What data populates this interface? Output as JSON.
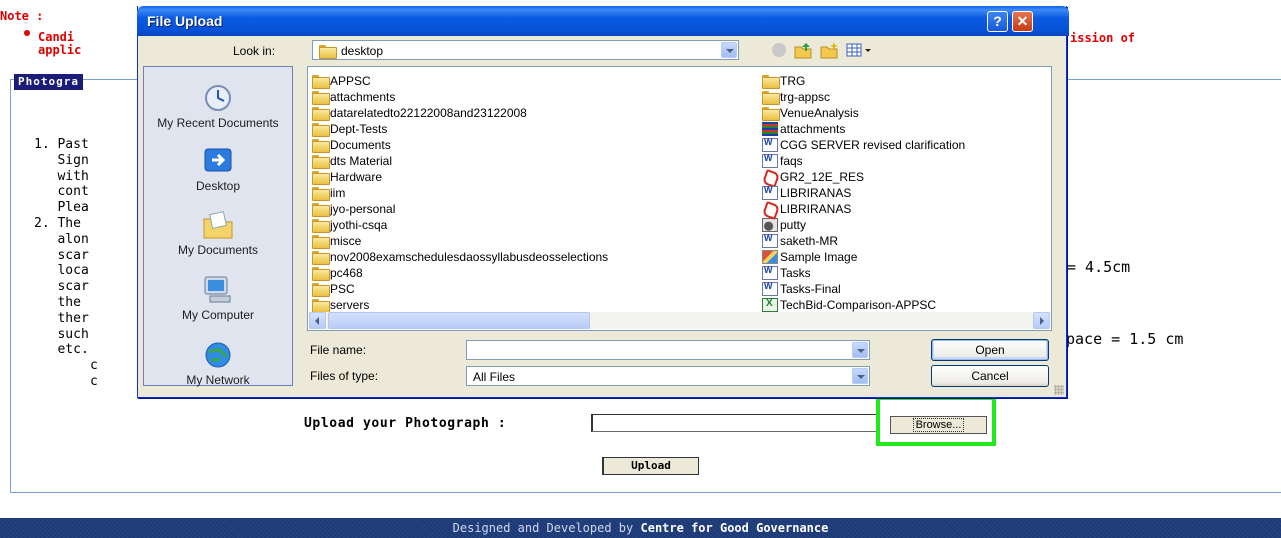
{
  "page": {
    "note_label": "Note :",
    "note_line1_visible": "Candi",
    "note_line2_visible": "applic",
    "note_line1_tail": "ission of",
    "section_header": "Photogra",
    "instructions_visible": [
      "1. Past",
      "   Sign",
      "   with",
      "   cont",
      "   Plea",
      "2. The",
      "   alon",
      "   scar",
      "   loca",
      "   scar",
      "   the",
      "   ther",
      "   such",
      "   etc."
    ],
    "instructions_extra": [
      "c",
      "c"
    ],
    "right_text_1": "= 4.5cm",
    "right_text_2": "pace = 1.5 cm",
    "upload_label": "Upload your Photograph :",
    "upload_value": "",
    "browse_label": "Browse...",
    "upload_button": "Upload",
    "footer_prefix": "Designed and Developed by",
    "footer_org": "Centre for Good Governance"
  },
  "dialog": {
    "title": "File Upload",
    "help_glyph": "?",
    "close_glyph": "✕",
    "look_in_label": "Look in:",
    "look_in_value": "desktop",
    "places": [
      {
        "label": "My Recent Documents",
        "icon": "recent-documents-icon"
      },
      {
        "label": "Desktop",
        "icon": "desktop-icon"
      },
      {
        "label": "My Documents",
        "icon": "my-documents-icon"
      },
      {
        "label": "My Computer",
        "icon": "my-computer-icon"
      },
      {
        "label": "My Network",
        "icon": "my-network-icon"
      }
    ],
    "files_col1": [
      {
        "name": "APPSC",
        "type": "folder"
      },
      {
        "name": "attachments",
        "type": "folder"
      },
      {
        "name": "datarelatedto22122008and23122008",
        "type": "folder"
      },
      {
        "name": "Dept-Tests",
        "type": "folder"
      },
      {
        "name": "Documents",
        "type": "folder"
      },
      {
        "name": "dts Material",
        "type": "folder"
      },
      {
        "name": "Hardware",
        "type": "folder"
      },
      {
        "name": "iim",
        "type": "folder"
      },
      {
        "name": "jyo-personal",
        "type": "folder"
      },
      {
        "name": "jyothi-csqa",
        "type": "folder"
      },
      {
        "name": "misce",
        "type": "folder"
      },
      {
        "name": "nov2008examschedulesdaossyllabusdeosselections",
        "type": "folder"
      },
      {
        "name": "pc468",
        "type": "folder"
      },
      {
        "name": "PSC",
        "type": "folder"
      },
      {
        "name": "servers",
        "type": "folder"
      }
    ],
    "files_col2": [
      {
        "name": "TRG",
        "type": "folder"
      },
      {
        "name": "trg-appsc",
        "type": "folder"
      },
      {
        "name": "VenueAnalysis",
        "type": "folder"
      },
      {
        "name": "attachments",
        "type": "archive"
      },
      {
        "name": "CGG SERVER revised clarification",
        "type": "word"
      },
      {
        "name": "faqs",
        "type": "word"
      },
      {
        "name": "GR2_12E_RES",
        "type": "pdf"
      },
      {
        "name": "LIBRIRANAS",
        "type": "word"
      },
      {
        "name": "LIBRIRANAS",
        "type": "pdf"
      },
      {
        "name": "putty",
        "type": "program"
      },
      {
        "name": "saketh-MR",
        "type": "word"
      },
      {
        "name": "Sample Image",
        "type": "image"
      },
      {
        "name": "Tasks",
        "type": "word"
      },
      {
        "name": "Tasks-Final",
        "type": "word"
      },
      {
        "name": "TechBid-Comparison-APPSC",
        "type": "excel"
      }
    ],
    "file_name_label": "File name:",
    "file_name_value": "",
    "files_of_type_label": "Files of type:",
    "files_of_type_value": "All Files",
    "open_label": "Open",
    "cancel_label": "Cancel"
  },
  "colors": {
    "highlight": "#22e81c",
    "note_red": "#e00000",
    "xp_title_blue": "#0652d8",
    "footer_blue": "#1d3a78"
  }
}
